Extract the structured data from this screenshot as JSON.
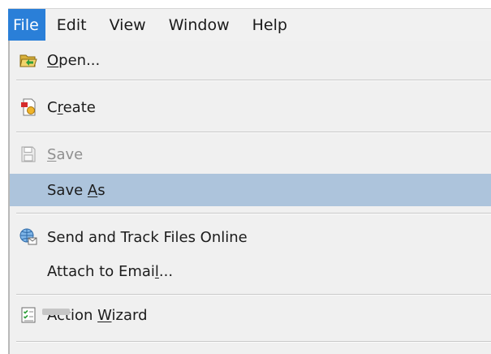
{
  "menubar": {
    "items": [
      {
        "label": "File",
        "active": true
      },
      {
        "label": "Edit"
      },
      {
        "label": "View"
      },
      {
        "label": "Window"
      },
      {
        "label": "Help"
      }
    ]
  },
  "file_menu": {
    "open": {
      "pre": "",
      "u": "O",
      "post": "pen...",
      "icon": "open-folder-icon"
    },
    "create": {
      "pre": "C",
      "u": "r",
      "post": "eate",
      "icon": "create-pdf-icon"
    },
    "save": {
      "pre": "",
      "u": "S",
      "post": "ave",
      "icon": "save-icon",
      "disabled": true
    },
    "save_as": {
      "pre": "Save ",
      "u": "A",
      "post": "s",
      "highlighted": true
    },
    "send_track": {
      "label": "Send and Track Files Online",
      "icon": "globe-send-icon"
    },
    "attach": {
      "pre": "Attach to Emai",
      "u": "l",
      "post": "..."
    },
    "action_wizard": {
      "pre": "Action ",
      "u": "W",
      "post": "izard",
      "icon": "checklist-icon"
    }
  },
  "colors": {
    "active_menu": "#2a7fd8",
    "highlight_row": "#adc4dc",
    "menu_bg": "#f0f0f0"
  }
}
